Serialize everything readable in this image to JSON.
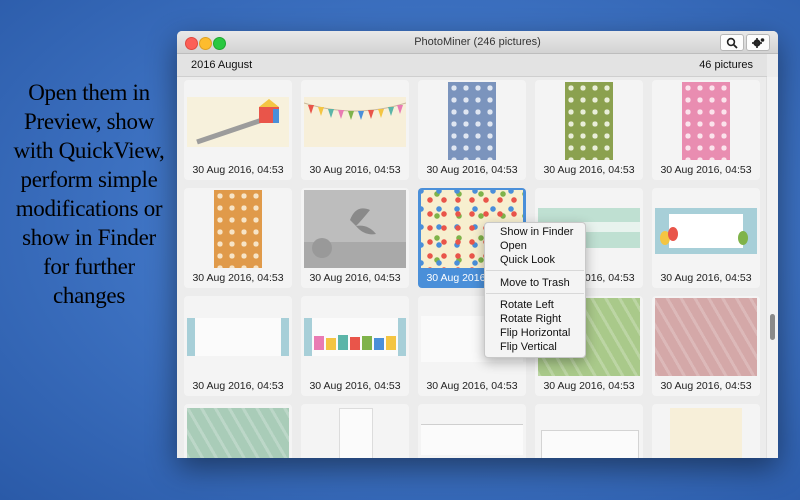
{
  "promo": {
    "lines": [
      "Open them in",
      "Preview, show",
      "with QuickView,",
      "perform simple",
      "modifications or",
      "show in Finder",
      "for further",
      "changes"
    ]
  },
  "window": {
    "title": "PhotoMiner (246 pictures)",
    "section_label": "2016 August",
    "section_count": "46 pictures"
  },
  "toolbar": {
    "search_icon": "magnifier-icon",
    "settings_icon": "gear-icon"
  },
  "photos": [
    {
      "caption": "30 Aug 2016, 04:53"
    },
    {
      "caption": "30 Aug 2016, 04:53"
    },
    {
      "caption": "30 Aug 2016, 04:53"
    },
    {
      "caption": "30 Aug 2016, 04:53"
    },
    {
      "caption": "30 Aug 2016, 04:53"
    },
    {
      "caption": "30 Aug 2016, 04:53"
    },
    {
      "caption": "30 Aug 2016, 04:53"
    },
    {
      "caption": "30 Aug 2016, 04:53"
    },
    {
      "caption": "30 Aug 2016, 04:53"
    },
    {
      "caption": "30 Aug 2016, 04:53"
    },
    {
      "caption": "30 Aug 2016, 04:53"
    },
    {
      "caption": "30 Aug 2016, 04:53"
    },
    {
      "caption": "30 Aug 2016, 04:53"
    },
    {
      "caption": "30 Aug 2016, 04:53"
    },
    {
      "caption": "30 Aug 2016, 04:53"
    }
  ],
  "context_menu": {
    "show_in_finder": "Show in Finder",
    "open": "Open",
    "quick_look": "Quick Look",
    "move_to_trash": "Move to Trash",
    "rotate_left": "Rotate Left",
    "rotate_right": "Rotate Right",
    "flip_horizontal": "Flip Horizontal",
    "flip_vertical": "Flip Vertical"
  },
  "colors": {
    "selection": "#4a8fd9",
    "desktop": "#3f74c4"
  }
}
